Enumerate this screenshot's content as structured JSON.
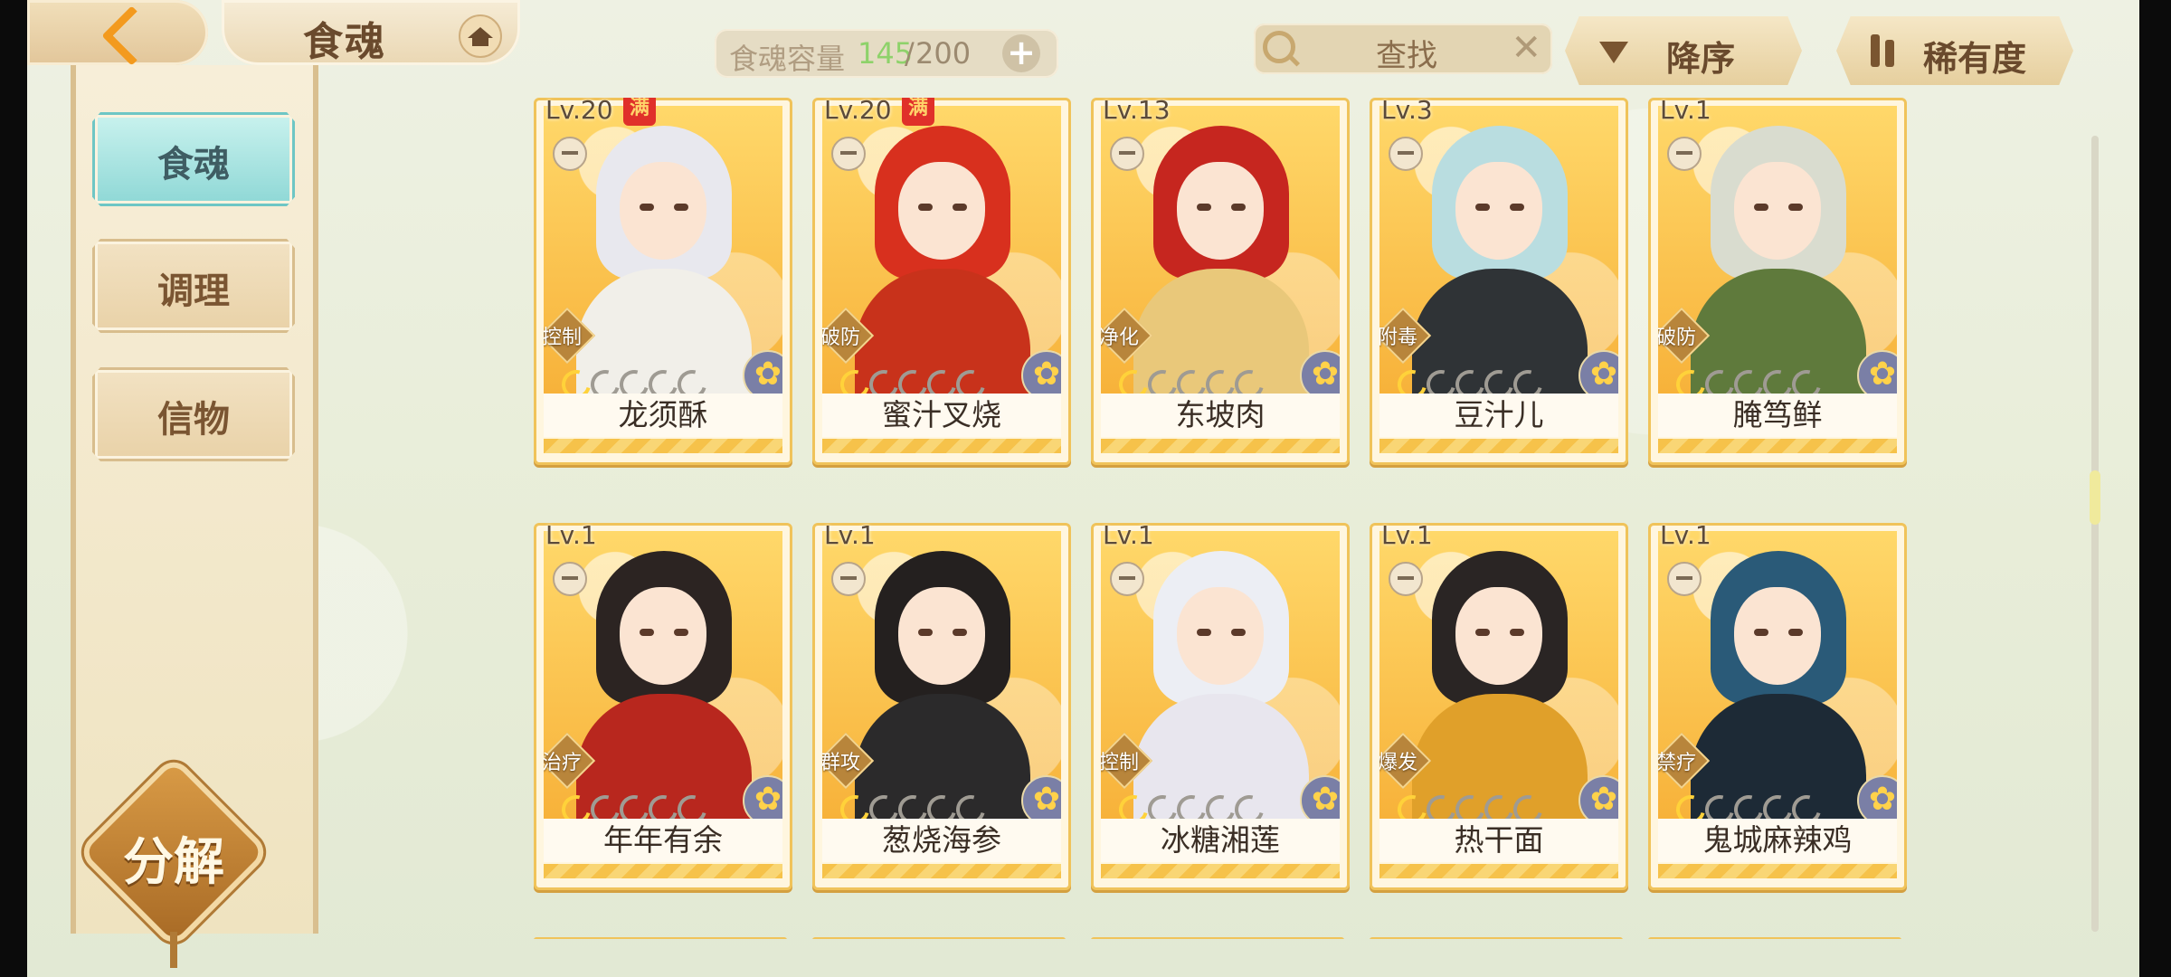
{
  "header": {
    "title": "食魂",
    "capacity": {
      "label": "食魂容量",
      "current": "145",
      "separator": "/",
      "max": "200"
    },
    "search_label": "查找",
    "sort_label": "降序",
    "filter_label": "稀有度"
  },
  "sidebar": {
    "tabs": [
      {
        "label": "食魂",
        "active": true
      },
      {
        "label": "调理",
        "active": false
      },
      {
        "label": "信物",
        "active": false
      }
    ],
    "decompose_label": "分解"
  },
  "cards": [
    {
      "level": "Lv.20",
      "full_mark": "满",
      "role": "控制",
      "stars": 1,
      "name": "龙须酥",
      "hair": "#e8e8ee",
      "outfit": "#f1efe9"
    },
    {
      "level": "Lv.20",
      "full_mark": "满",
      "role": "破防",
      "stars": 1,
      "name": "蜜汁叉烧",
      "hair": "#d8301e",
      "outfit": "#c8321b"
    },
    {
      "level": "Lv.13",
      "full_mark": "",
      "role": "净化",
      "stars": 1,
      "name": "东坡肉",
      "hair": "#c6261f",
      "outfit": "#e9c87a"
    },
    {
      "level": "Lv.3",
      "full_mark": "",
      "role": "附毒",
      "stars": 1,
      "name": "豆汁儿",
      "hair": "#b9dde0",
      "outfit": "#2f3336"
    },
    {
      "level": "Lv.1",
      "full_mark": "",
      "role": "破防",
      "stars": 1,
      "name": "腌笃鲜",
      "hair": "#d9dccf",
      "outfit": "#5f7a3c"
    },
    {
      "level": "Lv.1",
      "full_mark": "",
      "role": "治疗",
      "stars": 1,
      "name": "年年有余",
      "hair": "#2c2422",
      "outfit": "#b8271e"
    },
    {
      "level": "Lv.1",
      "full_mark": "",
      "role": "群攻",
      "stars": 1,
      "name": "葱烧海参",
      "hair": "#24201f",
      "outfit": "#2b2a2b"
    },
    {
      "level": "Lv.1",
      "full_mark": "",
      "role": "控制",
      "stars": 1,
      "name": "冰糖湘莲",
      "hair": "#eceef4",
      "outfit": "#e8e6ee"
    },
    {
      "level": "Lv.1",
      "full_mark": "",
      "role": "爆发",
      "stars": 1,
      "name": "热干面",
      "hair": "#2a2524",
      "outfit": "#e0a02a"
    },
    {
      "level": "Lv.1",
      "full_mark": "",
      "role": "禁疗",
      "stars": 1,
      "name": "鬼城麻辣鸡",
      "hair": "#2a5a78",
      "outfit": "#1d2a36"
    }
  ]
}
